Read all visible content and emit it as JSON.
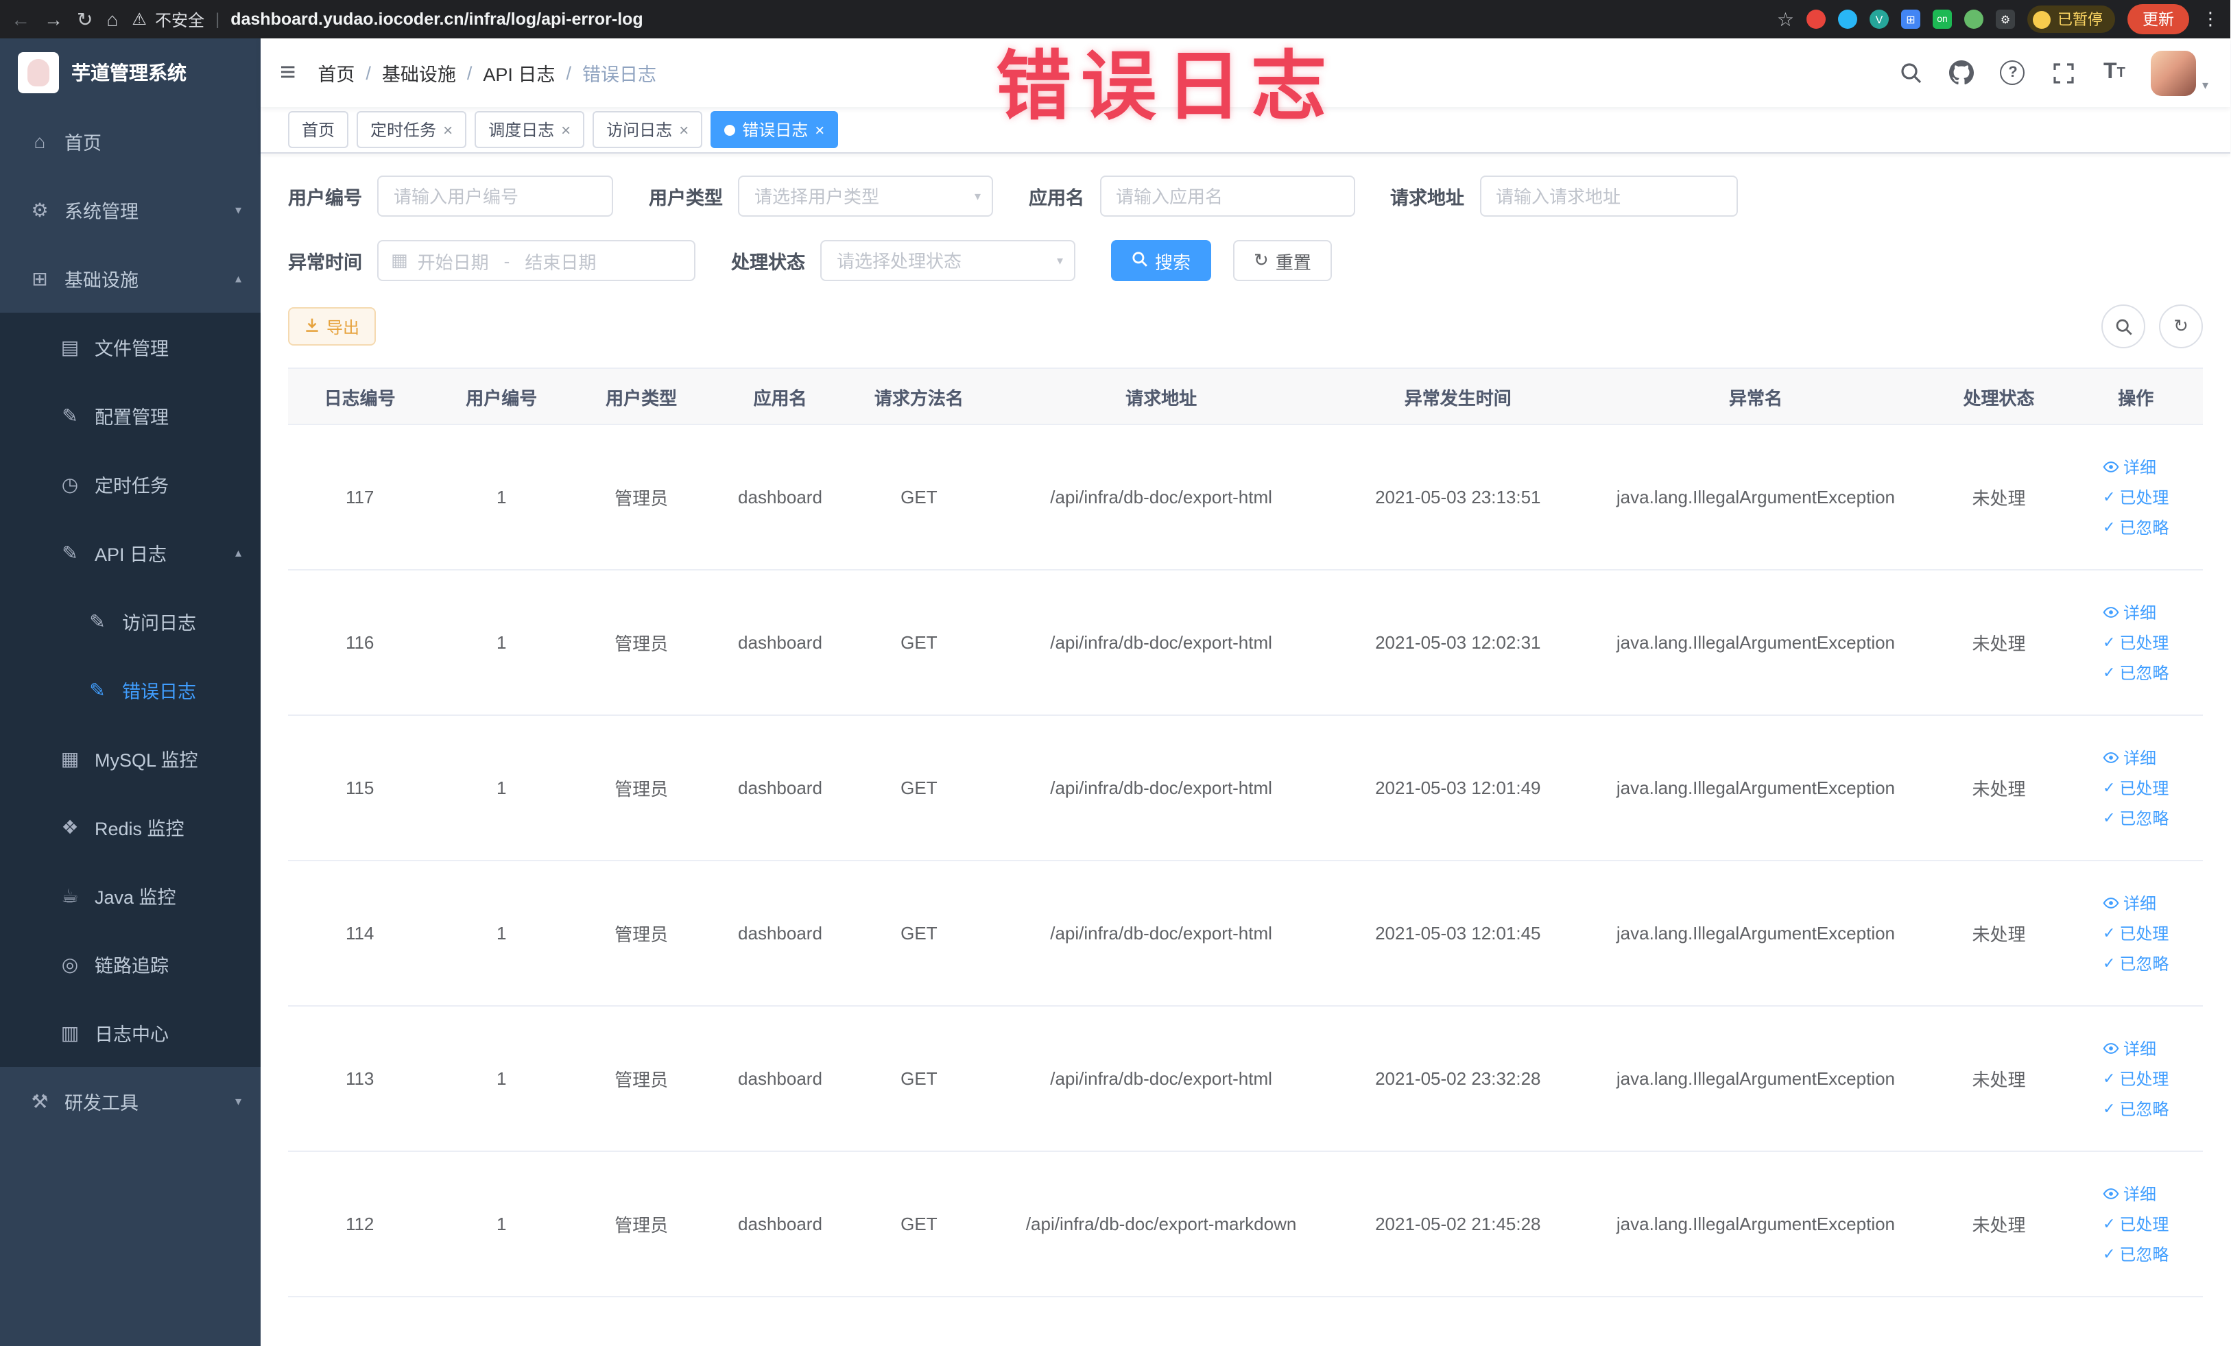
{
  "browser": {
    "security_label": "不安全",
    "url": "dashboard.yudao.iocoder.cn/infra/log/api-error-log",
    "extension_on_badge": "on",
    "paused_label": "已暂停",
    "update_label": "更新"
  },
  "annotation_text": "错误日志",
  "sidebar": {
    "logo_title": "芋道管理系统",
    "items": [
      {
        "label": "首页"
      },
      {
        "label": "系统管理"
      },
      {
        "label": "基础设施"
      },
      {
        "label": "文件管理"
      },
      {
        "label": "配置管理"
      },
      {
        "label": "定时任务"
      },
      {
        "label": "API 日志"
      },
      {
        "label": "访问日志"
      },
      {
        "label": "错误日志"
      },
      {
        "label": "MySQL 监控"
      },
      {
        "label": "Redis 监控"
      },
      {
        "label": "Java 监控"
      },
      {
        "label": "链路追踪"
      },
      {
        "label": "日志中心"
      },
      {
        "label": "研发工具"
      }
    ]
  },
  "navbar": {
    "breadcrumb": [
      "首页",
      "基础设施",
      "API 日志",
      "错误日志"
    ]
  },
  "tags": [
    {
      "label": "首页"
    },
    {
      "label": "定时任务"
    },
    {
      "label": "调度日志"
    },
    {
      "label": "访问日志"
    },
    {
      "label": "错误日志"
    }
  ],
  "filters": {
    "user_id": {
      "label": "用户编号",
      "placeholder": "请输入用户编号"
    },
    "user_type": {
      "label": "用户类型",
      "placeholder": "请选择用户类型"
    },
    "app_name": {
      "label": "应用名",
      "placeholder": "请输入应用名"
    },
    "request_url": {
      "label": "请求地址",
      "placeholder": "请输入请求地址"
    },
    "exception_time": {
      "label": "异常时间",
      "start_placeholder": "开始日期",
      "separator": "-",
      "end_placeholder": "结束日期"
    },
    "process_status": {
      "label": "处理状态",
      "placeholder": "请选择处理状态"
    },
    "search_label": "搜索",
    "reset_label": "重置"
  },
  "toolbar": {
    "export_label": "导出"
  },
  "table": {
    "columns": [
      "日志编号",
      "用户编号",
      "用户类型",
      "应用名",
      "请求方法名",
      "请求地址",
      "异常发生时间",
      "异常名",
      "处理状态",
      "操作"
    ],
    "actions": {
      "detail": "详细",
      "processed": "已处理",
      "ignored": "已忽略"
    },
    "rows": [
      {
        "id": "117",
        "user_id": "1",
        "user_type": "管理员",
        "app": "dashboard",
        "method": "GET",
        "url": "/api/infra/db-doc/export-html",
        "time": "2021-05-03 23:13:51",
        "exception": "java.lang.IllegalArgumentException",
        "status": "未处理"
      },
      {
        "id": "116",
        "user_id": "1",
        "user_type": "管理员",
        "app": "dashboard",
        "method": "GET",
        "url": "/api/infra/db-doc/export-html",
        "time": "2021-05-03 12:02:31",
        "exception": "java.lang.IllegalArgumentException",
        "status": "未处理"
      },
      {
        "id": "115",
        "user_id": "1",
        "user_type": "管理员",
        "app": "dashboard",
        "method": "GET",
        "url": "/api/infra/db-doc/export-html",
        "time": "2021-05-03 12:01:49",
        "exception": "java.lang.IllegalArgumentException",
        "status": "未处理"
      },
      {
        "id": "114",
        "user_id": "1",
        "user_type": "管理员",
        "app": "dashboard",
        "method": "GET",
        "url": "/api/infra/db-doc/export-html",
        "time": "2021-05-03 12:01:45",
        "exception": "java.lang.IllegalArgumentException",
        "status": "未处理"
      },
      {
        "id": "113",
        "user_id": "1",
        "user_type": "管理员",
        "app": "dashboard",
        "method": "GET",
        "url": "/api/infra/db-doc/export-html",
        "time": "2021-05-02 23:32:28",
        "exception": "java.lang.IllegalArgumentException",
        "status": "未处理"
      },
      {
        "id": "112",
        "user_id": "1",
        "user_type": "管理员",
        "app": "dashboard",
        "method": "GET",
        "url": "/api/infra/db-doc/export-markdown",
        "time": "2021-05-02 21:45:28",
        "exception": "java.lang.IllegalArgumentException",
        "status": "未处理"
      }
    ]
  }
}
